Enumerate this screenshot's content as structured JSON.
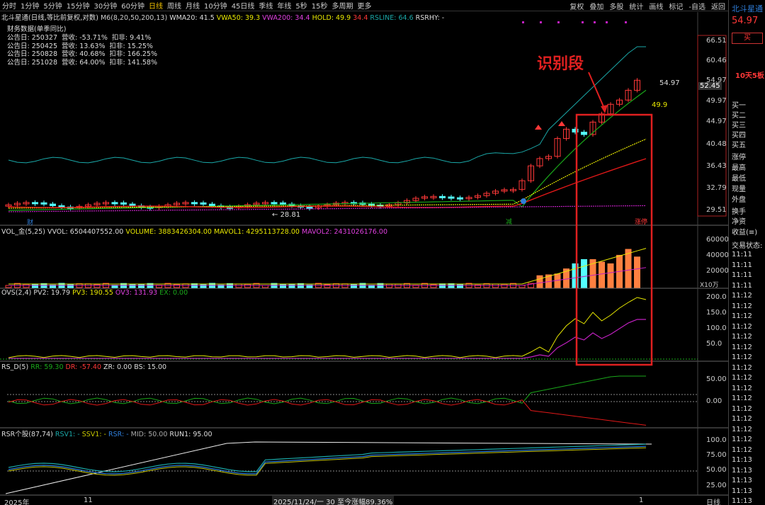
{
  "toolbar": {
    "items": [
      "分时",
      "1分钟",
      "5分钟",
      "15分钟",
      "30分钟",
      "60分钟",
      "日线",
      "周线",
      "月线",
      "10分钟",
      "45日线",
      "季线",
      "年线",
      "5秒",
      "15秒",
      "多周期",
      "更多"
    ],
    "active_index": 6,
    "right_items": [
      "复权",
      "叠加",
      "多股",
      "统计",
      "画线",
      "标记",
      "-自选",
      "返回"
    ]
  },
  "main_panel": {
    "title": "北斗星通(日线,等比前复权,对数)",
    "indicator": "M6(8,20,50,200,13)",
    "wma20": "WMA20: 41.5",
    "vwa50": "VWA50: 39.3",
    "vwa200": "VWA200: 34.4",
    "hold": "HOLD: 49.9",
    "hold_b": "34.4",
    "rsline": "RSLINE: 64.6",
    "rsrhy": "RSRHY: -",
    "finance_title": "财务数据(单季同比)",
    "finance": [
      "公告日: 250327  营收: -53.71%  扣非: 9.41%",
      "公告日: 250425  营收: 13.63%  扣非: 15.25%",
      "公告日: 250828  营收: 40.68%  扣非: 166.25%",
      "公告日: 251028  营收: 64.00%  扣非: 141.58%"
    ],
    "annotation": "识别段",
    "price_last": "54.97",
    "price_tag": "52.45",
    "price_hold": "49.9",
    "low_label": "28.81",
    "tag_cai": "财",
    "tag_jian": "减",
    "tag_zhangting": "涨停",
    "y_ticks": [
      "66.51",
      "60.46",
      "54.97",
      "49.97",
      "44.97",
      "40.48",
      "36.43",
      "32.79",
      "29.51"
    ]
  },
  "vol_panel": {
    "title": "VOL_金(5,25)",
    "vvol": "VVOL: 6504407552.00",
    "volume": "VOLUME: 3883426304.00",
    "mavol1": "MAVOL1: 4295113728.00",
    "mavol2": "MAVOL2: 2431026176.00",
    "y_ticks": [
      "60000",
      "40000",
      "20000"
    ],
    "unit": "X10万"
  },
  "ovs_panel": {
    "title": "OVS(2,4)",
    "pv2": "PV2: 19.79",
    "pv3": "PV3: 190.55",
    "ov3": "OV3: 131.93",
    "ex": "EX: 0.00",
    "y_ticks": [
      "200.0",
      "150.0",
      "100.0",
      "50.0"
    ]
  },
  "rsd_panel": {
    "title": "RS_D(5)",
    "rr": "RR: 59.30",
    "dr": "DR: -57.40",
    "zr": "ZR: 0.00",
    "bs": "BS: 15.00",
    "y_ticks": [
      "50.00",
      "0.00"
    ]
  },
  "rsr_panel": {
    "title": "RSR个股(87,74)",
    "rsv1": "RSV1: -",
    "ssv1": "SSV1: -",
    "rsr": "RSR: -",
    "mid": "MID: 50.00",
    "run1": "RUN1: 95.00",
    "y_ticks": [
      "100.0",
      "75.00",
      "50.00",
      "25.00"
    ]
  },
  "x_axis": {
    "labels": [
      "2025年",
      "11",
      "1"
    ],
    "status": "2025/11/24/一 30 至今涨幅89.36%",
    "right_label": "日线"
  },
  "sidebar": {
    "stock_name": "北斗星通",
    "price": "54.97",
    "buy_btn": "买",
    "board": "10天5板",
    "rows": [
      "买一",
      "买二",
      "买三",
      "买四",
      "买五",
      "涨停",
      "最高",
      "最低",
      "现量",
      "外盘",
      "换手",
      "净资",
      "收益(≡)",
      "交易状态:"
    ],
    "times": [
      "11:11",
      "11:11",
      "11:11",
      "11:11",
      "11:12",
      "11:12",
      "11:12",
      "11:12",
      "11:12",
      "11:12",
      "11:12",
      "11:12",
      "11:12",
      "11:12",
      "11:12",
      "11:12",
      "11:12",
      "11:12",
      "11:12",
      "11:12",
      "11:13",
      "11:13",
      "11:13",
      "11:13",
      "11:13",
      "11:13",
      "11:13",
      "11:13",
      "11:13",
      "11:13",
      "11:13",
      "11:13"
    ]
  },
  "colors": {
    "up": "#ff3838",
    "down": "#54ffff",
    "annot": "#e02020"
  }
}
